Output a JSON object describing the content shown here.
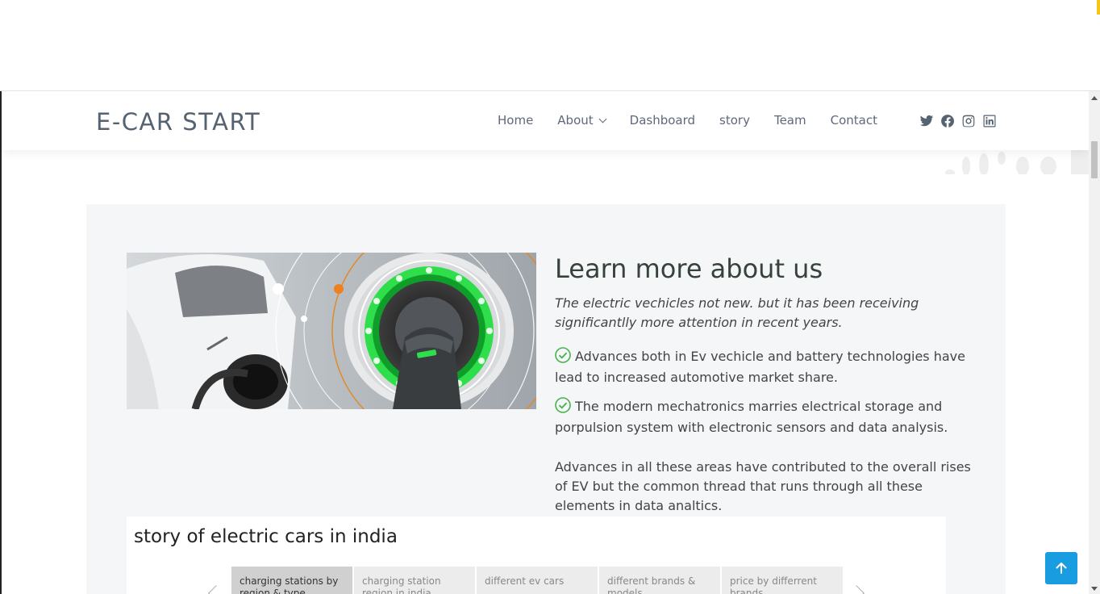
{
  "brand": {
    "logo": "E-CAR START"
  },
  "nav": {
    "items": [
      {
        "label": "Home"
      },
      {
        "label": "About",
        "dropdown": true
      },
      {
        "label": "Dashboard"
      },
      {
        "label": "story"
      },
      {
        "label": "Team"
      },
      {
        "label": "Contact"
      }
    ],
    "socials": [
      "twitter-icon",
      "facebook-icon",
      "instagram-icon",
      "linkedin-icon"
    ]
  },
  "about": {
    "title": "Learn more about us",
    "lead": "The electric vechicles not new. but it has been receiving significantlly more attention in recent years.",
    "points": [
      "Advances both in Ev vechicle and battery technologies have lead to increased automotive market share.",
      "The modern mechatronics marries electrical storage and porpulsion system with electronic sensors and data analysis."
    ],
    "paragraph": "Advances in all these areas have contributed to the overall rises of EV but the common thread that runs through all these elements in data analtics."
  },
  "story": {
    "title": "story of electric cars in india",
    "tabs": [
      {
        "label": "charging stations by region & type",
        "active": true
      },
      {
        "label": "charging station region in india"
      },
      {
        "label": "different ev cars"
      },
      {
        "label": "different brands & models"
      },
      {
        "label": "price by differrent brands"
      }
    ]
  },
  "colors": {
    "accent": "#1a9ce0",
    "check": "#47b24c",
    "charger_glow": "#2ede4a"
  }
}
